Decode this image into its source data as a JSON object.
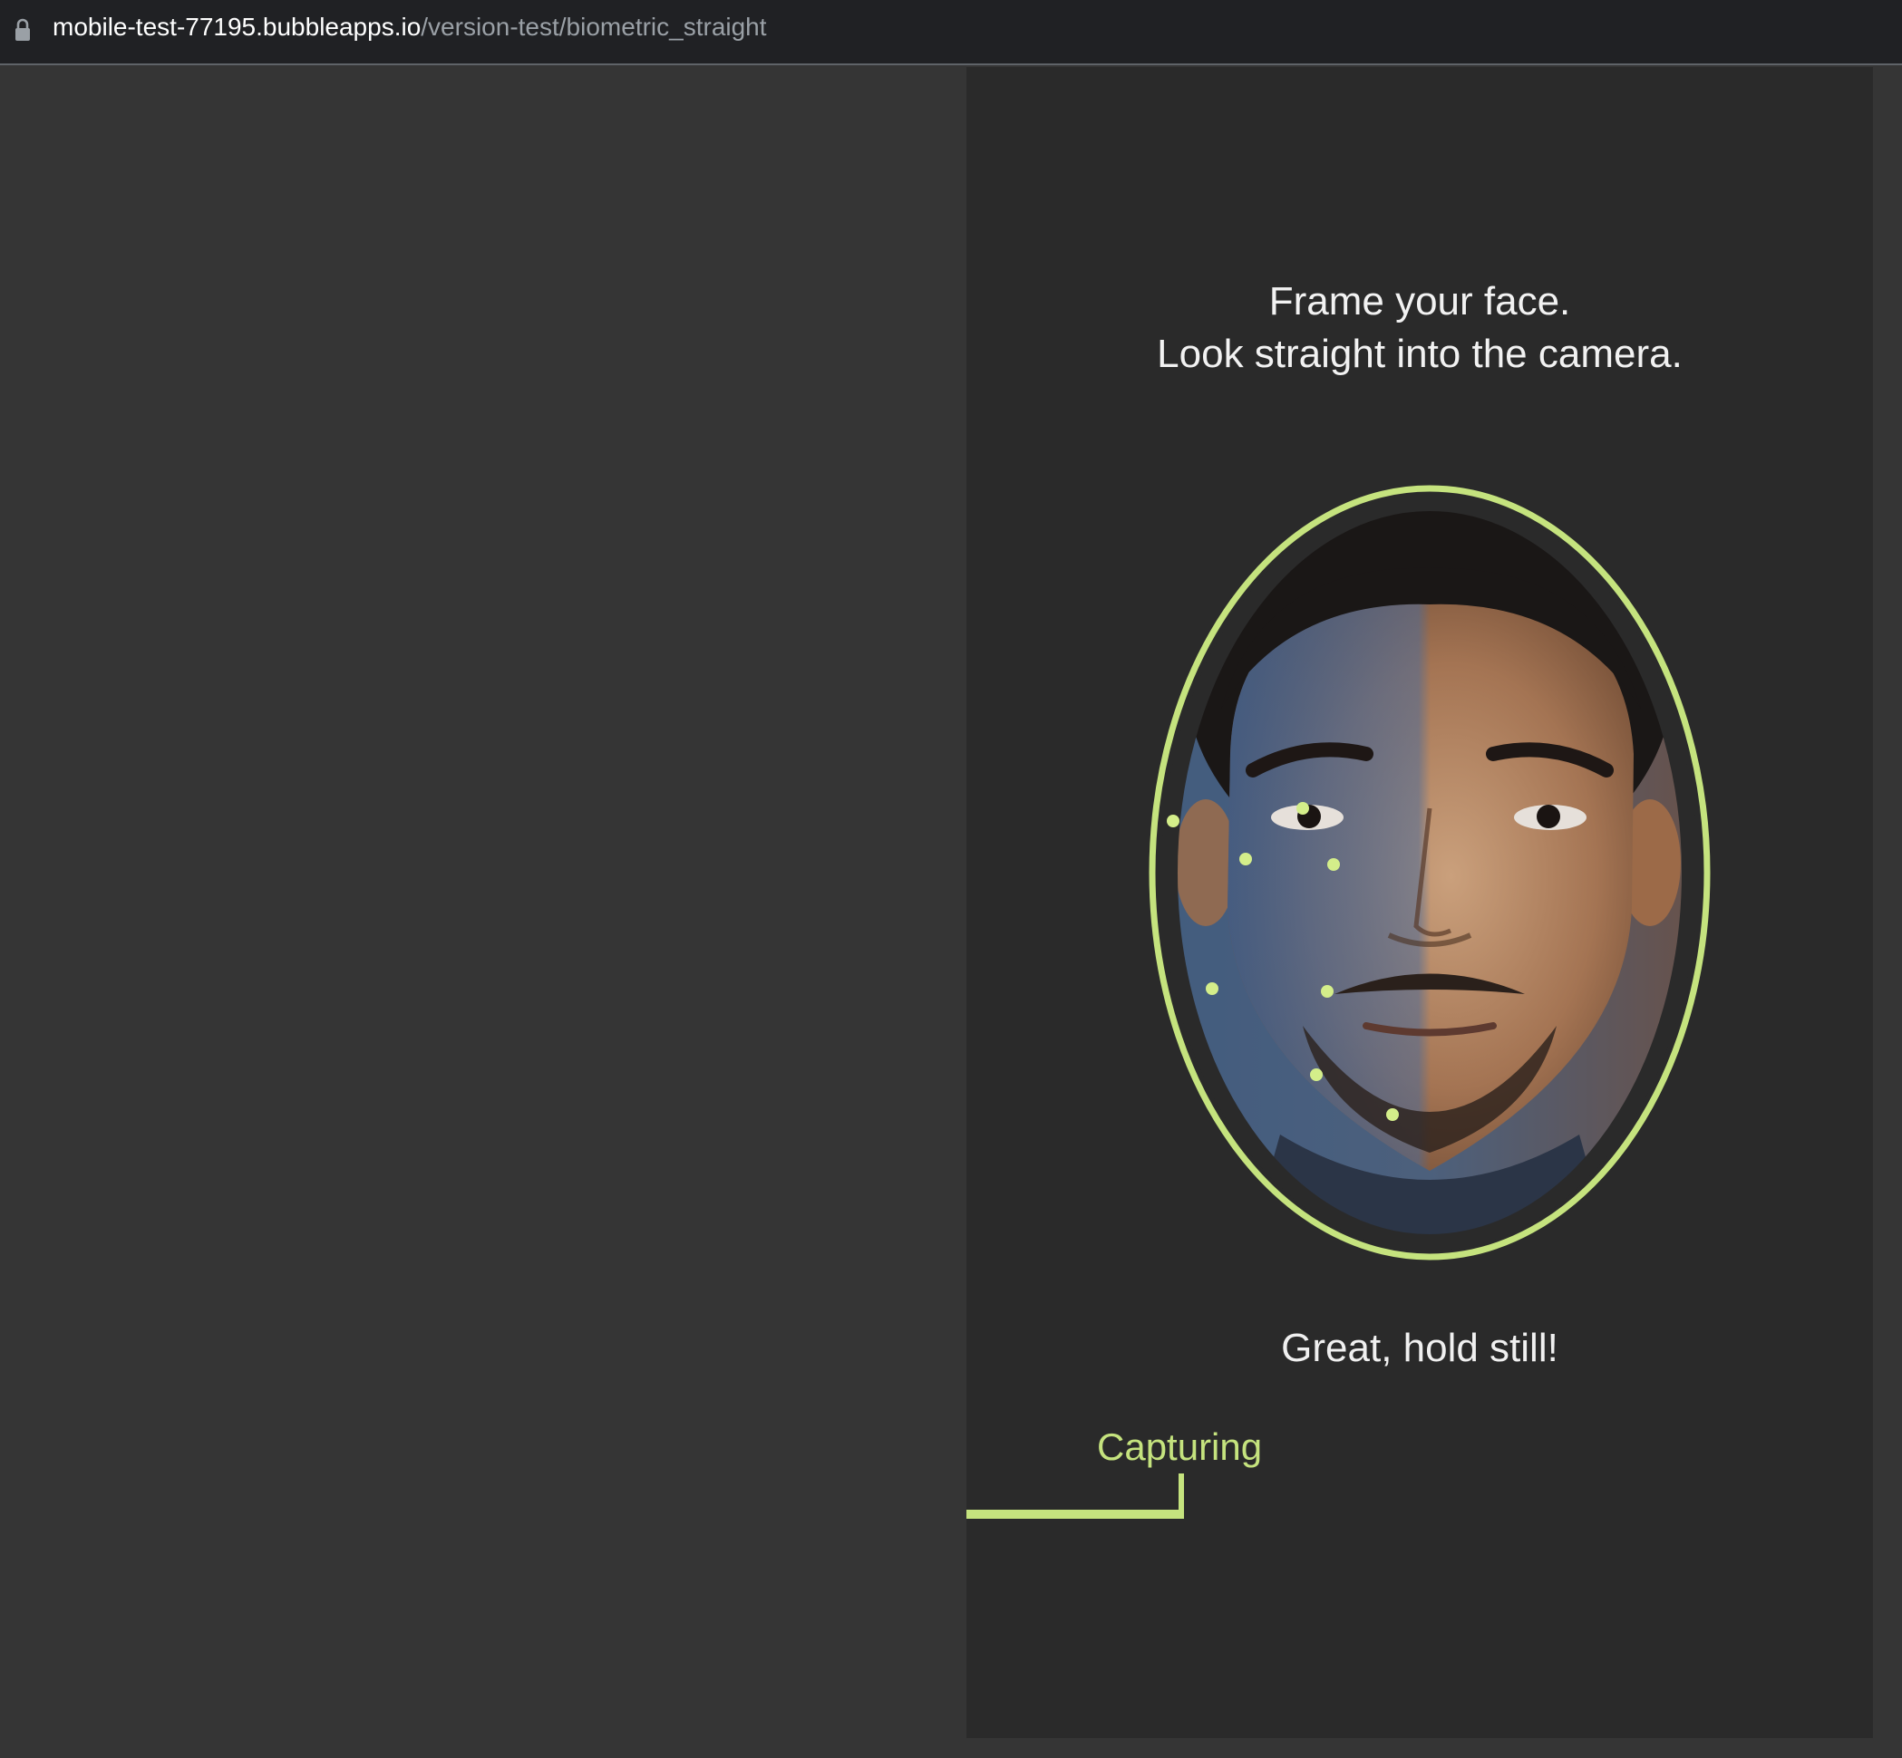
{
  "browser": {
    "url_host": "mobile-test-77195.bubbleapps.io",
    "url_path": "/version-test/biometric_straight"
  },
  "screen": {
    "instruction_line1": "Frame your face.",
    "instruction_line2": "Look straight into the camera.",
    "status": "Great, hold still!",
    "capturing_label": "Capturing",
    "capture_progress": 0.24
  },
  "colors": {
    "accent": "#c5e37e",
    "background": "#353535",
    "panel": "#2a2a2a"
  },
  "icons": {
    "address_bar": "lock-icon",
    "camera_view": "face-photo"
  }
}
